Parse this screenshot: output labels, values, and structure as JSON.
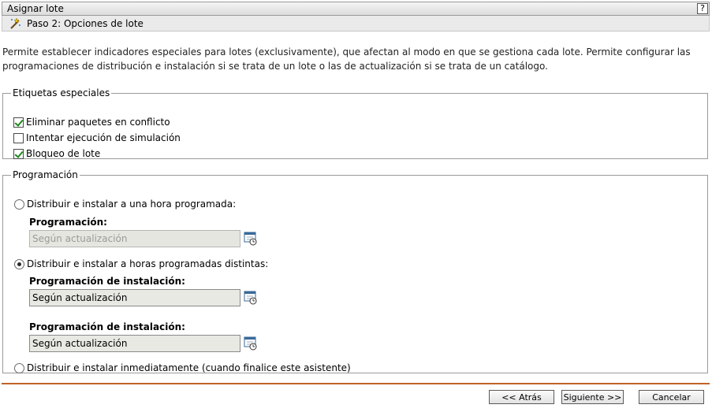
{
  "window": {
    "title": "Asignar lote",
    "help_label": "?"
  },
  "step": {
    "title": "Paso 2: Opciones de lote"
  },
  "intro": "Permite establecer indicadores especiales para lotes (exclusivamente), que afectan al modo en que se gestiona cada lote. Permite configurar las programaciones de distribución e instalación si se trata de un lote o las de actualización si se trata de un catálogo.",
  "flags": {
    "legend": "Etiquetas especiales",
    "items": [
      {
        "label": "Eliminar paquetes en conflicto",
        "checked": true
      },
      {
        "label": "Intentar ejecución de simulación",
        "checked": false
      },
      {
        "label": "Bloqueo de lote",
        "checked": true
      }
    ]
  },
  "schedule": {
    "legend": "Programación",
    "option1": {
      "label": "Distribuir e instalar a una hora programada:",
      "selected": false
    },
    "option1_field": {
      "label": "Programación:",
      "value": "Según actualización"
    },
    "option2": {
      "label": "Distribuir e instalar a horas programadas distintas:",
      "selected": true
    },
    "option2_field1": {
      "label": "Programación de instalación:",
      "value": "Según actualización"
    },
    "option2_field2": {
      "label": "Programación de instalación:",
      "value": "Según actualización"
    },
    "option3": {
      "label": "Distribuir e instalar inmediatamente (cuando finalice este asistente)",
      "selected": false
    }
  },
  "buttons": {
    "back": "<< Atrás",
    "next": "Siguiente >>",
    "cancel": "Cancelar"
  },
  "icons": {
    "step": "wizard-wand-icon",
    "schedule": "calendar-clock-icon"
  },
  "colors": {
    "divider": "#c0622a",
    "check": "#1a8a1a"
  }
}
